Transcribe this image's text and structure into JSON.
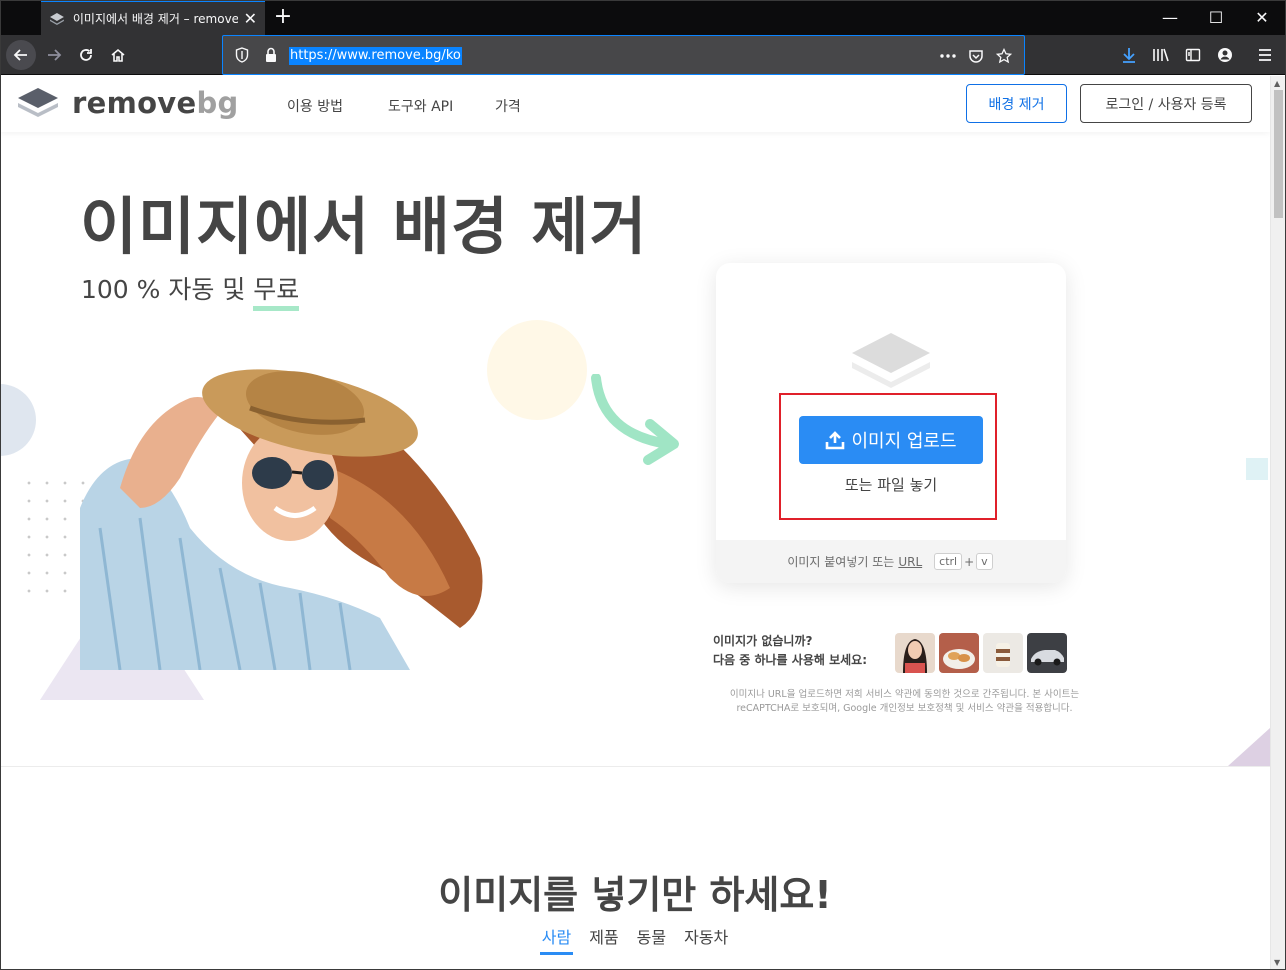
{
  "browser": {
    "tab_title": "이미지에서 배경 제거 – remove.bg",
    "new_tab_symbol": "+",
    "tab_close_symbol": "✕",
    "url": "https://www.remove.bg/ko",
    "window_minimize": "—",
    "window_maximize": "☐",
    "window_close": "✕"
  },
  "header": {
    "logo_text_main": "remove",
    "logo_text_accent": "bg",
    "nav": [
      "이용 방법",
      "도구와 API",
      "가격"
    ],
    "remove_bg_button": "배경 제거",
    "login_button": "로그인 / 사용자 등록"
  },
  "hero": {
    "title": "이미지에서 배경 제거",
    "subtitle_prefix": "100 % 자동 및 ",
    "subtitle_free": "무료"
  },
  "upload": {
    "button_label": "이미지 업로드",
    "drop_text": "또는 파일 놓기",
    "paste_text": "이미지 붙여넣기 또는",
    "url_link": "URL",
    "kbd_ctrl": "ctrl",
    "kbd_plus": "+",
    "kbd_v": "v"
  },
  "samples": {
    "line1": "이미지가 없습니까?",
    "line2": "다음 중 하나를 사용해 보세요:",
    "items": [
      "woman-sample",
      "food-sample",
      "dessert-sample",
      "car-sample"
    ]
  },
  "legal": {
    "text": "이미지나 URL을 업로드하면 저희 서비스 약관에 동의한 것으로 간주됩니다. 본 사이트는 reCAPTCHA로 보호되며, Google 개인정보 보호정책 및 서비스 약관을 적용합니다."
  },
  "section2": {
    "title": "이미지를 넣기만 하세요!",
    "tabs": [
      "사람",
      "제품",
      "동물",
      "자동차"
    ],
    "active_tab": "사람"
  },
  "colors": {
    "brand_blue": "#2a8cf4",
    "link_blue": "#0f70e6",
    "text_dark": "#454545",
    "highlight_red": "#e0202a",
    "free_underline": "#a7e8c8"
  }
}
